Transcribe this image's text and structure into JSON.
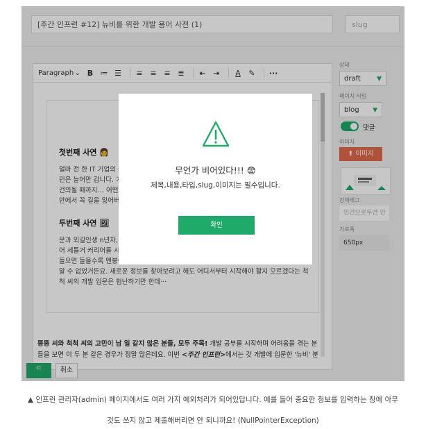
{
  "post": {
    "title_value": "[주간 인프런 #12] 뉴비를 위한 개발 용어 사전 (1)",
    "slug_placeholder": "slug"
  },
  "toolbar": {
    "paragraph": "Paragraph",
    "bold": "B",
    "more": "···"
  },
  "content": {
    "heading1": "첫번째 사연 👩",
    "para1": [
      "얼마 전 한 IT 기업의 운영",
      "민은 늘어만 갑니다. 기획",
      "건의될 때까지… 어떤 업",
      "안에서 꼭 길을 잃어버린"
    ],
    "heading2": "두번째 사연 🖼",
    "para2": [
      "문과 외길인생 n년차, '빠",
      "어 세틀거 커리어를 시작",
      "들으면 들을수록 멘붕이 점점 커져 갈 뿐입니다. 책도 사 보았지만 조금씩 알겠는",
      "알 수 없었거든요. 새로운 정보를 찾아보려고 해도 어디서부터 시작해야 할지 모르겠다는 척",
      "척 씨의 개발 입문은 험난하기만 한데···"
    ],
    "below_line1_bold": "뚱뚱 씨와 척척 씨의 고민이 남 일 같지 않은 분들, 모두 주목!",
    "below_line1_rest": " 개발 공부를 시작하며 어려움을 겪는 분",
    "below_line2_a": "들을 보면 이 두 분 같은 경우가 정말 많은데요. 이번 ",
    "below_line2_em": "<주간 인프런>",
    "below_line2_b": "에서는 갓 개발에 입문한 '뉴비' 분"
  },
  "sidebar": {
    "status_label": "상태",
    "status_value": "draft",
    "page_type_label": "페이지 타입",
    "page_type_value": "blog",
    "comment_label": "댓글",
    "image_label": "이미지",
    "image_button": "이미지",
    "lecture_tag_label": "강의태그",
    "lecture_tag_placeholder": "인건으로두면 안",
    "width_label": "가로폭",
    "width_value": "650px"
  },
  "actions": {
    "save_label": "ᄃ",
    "cancel_label": "취소"
  },
  "modal": {
    "title": "무언가 비어있다!!! 😨",
    "message": "제목,내용,타입,slug,이미지는 필수입니다.",
    "confirm": "확인"
  },
  "caption": {
    "line1": "▲ 인프런 관리자(admin) 페이지에서도 여러 가지 예외처리가 되어있답니다. 예를 들어 중요한 정보를 입력하는 창에 아무",
    "line2": "것도 쓰지 않고 제출해버리면 안 되니까요! (NullPointerException)"
  },
  "colors": {
    "accent": "#1faa6a",
    "danger": "#e06a4a"
  }
}
